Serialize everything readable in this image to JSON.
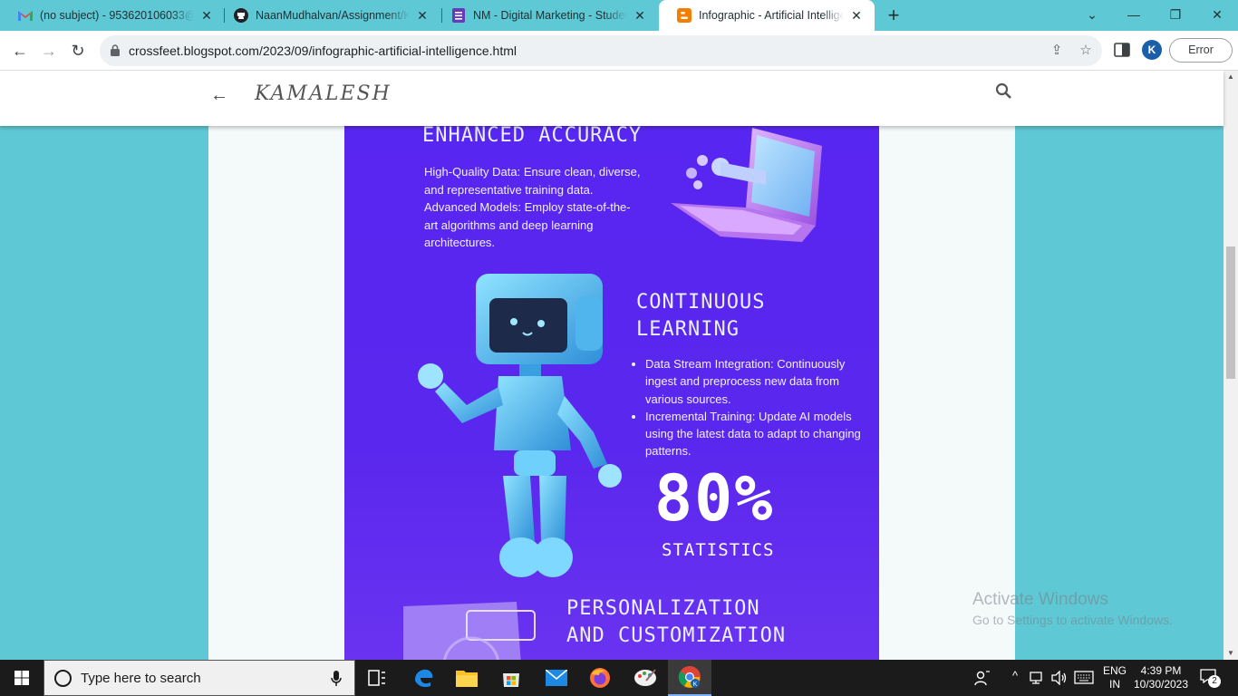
{
  "browser": {
    "tabs": [
      {
        "label": "(no subject) - 953620106033@",
        "icon": "gmail-icon"
      },
      {
        "label": "NaanMudhalvan/Assignment/Ka",
        "icon": "github-icon"
      },
      {
        "label": "NM - Digital Marketing - Studen",
        "icon": "forms-icon"
      },
      {
        "label": "Infographic - Artificial Intelligenc",
        "icon": "blogger-icon"
      }
    ],
    "url": "crossfeet.blogspot.com/2023/09/infographic-artificial-intelligence.html",
    "profile_initial": "K",
    "error_label": "Error"
  },
  "blog": {
    "title": "KAMALESH"
  },
  "infographic": {
    "section1_heading": "ENHANCED ACCURACY",
    "section1_lines": [
      "High-Quality Data: Ensure clean, diverse,",
      "and representative training data.",
      "Advanced Models: Employ state-of-the-",
      "art algorithms and deep learning",
      "architectures."
    ],
    "section2_heading_line1": "CONTINUOUS",
    "section2_heading_line2": "LEARNING",
    "section2_bullets": [
      "Data Stream Integration: Continuously ingest and preprocess new data from various sources.",
      "Incremental Training: Update AI models using the latest data to adapt to changing patterns."
    ],
    "stat_value": "80%",
    "stat_label": "STATISTICS",
    "section3_heading_line1": "PERSONALIZATION",
    "section3_heading_line2": "AND CUSTOMIZATION"
  },
  "watermark": {
    "line1": "Activate Windows",
    "line2": "Go to Settings to activate Windows."
  },
  "taskbar": {
    "search_placeholder": "Type here to search",
    "lang_line1": "ENG",
    "lang_line2": "IN",
    "time": "4:39 PM",
    "date": "10/30/2023",
    "notification_count": "2"
  }
}
